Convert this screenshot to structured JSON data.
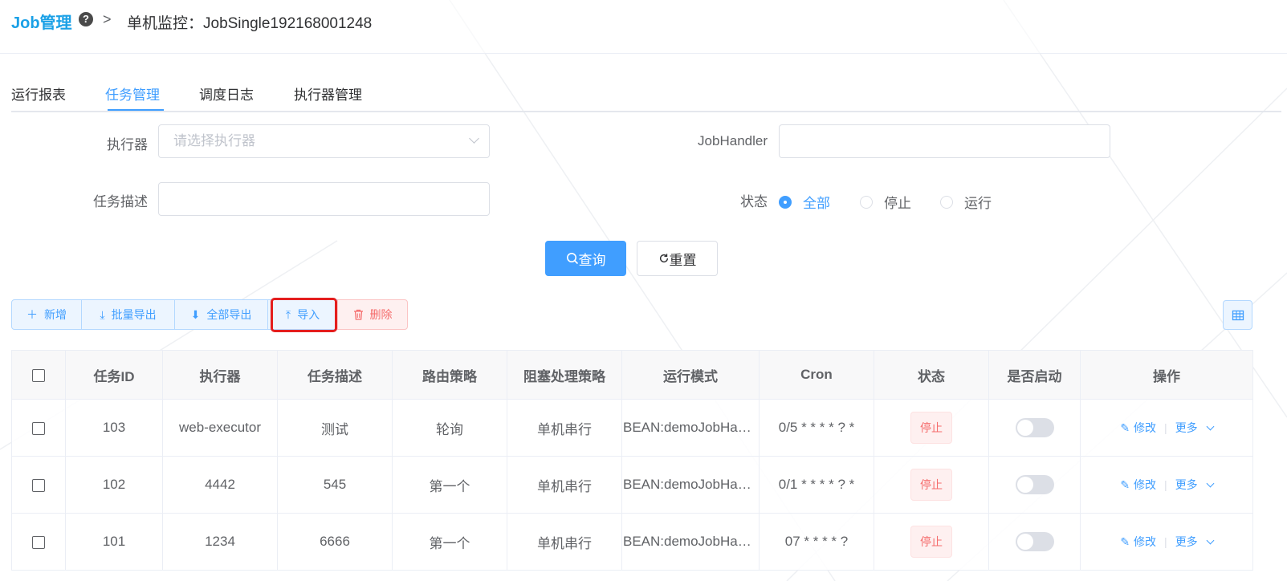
{
  "header": {
    "brand": "Job管理",
    "help_icon": "?",
    "separator": ">",
    "title": "单机监控：JobSingle192168001248"
  },
  "tabs": [
    {
      "label": "运行报表",
      "active": false
    },
    {
      "label": "任务管理",
      "active": true
    },
    {
      "label": "调度日志",
      "active": false
    },
    {
      "label": "执行器管理",
      "active": false
    }
  ],
  "form": {
    "executor_label": "执行器",
    "executor_placeholder": "请选择执行器",
    "jobhandler_label": "JobHandler",
    "jobhandler_value": "",
    "desc_label": "任务描述",
    "desc_value": "",
    "status_label": "状态",
    "status_options": [
      {
        "label": "全部",
        "checked": true
      },
      {
        "label": "停止",
        "checked": false
      },
      {
        "label": "运行",
        "checked": false
      }
    ],
    "search_label": "查询",
    "reset_label": "重置"
  },
  "toolbar": {
    "add": "新增",
    "batch_export": "批量导出",
    "export_all": "全部导出",
    "import": "导入",
    "delete": "删除"
  },
  "table": {
    "headers": [
      "任务ID",
      "执行器",
      "任务描述",
      "路由策略",
      "阻塞处理策略",
      "运行模式",
      "Cron",
      "状态",
      "是否启动",
      "操作"
    ],
    "rows": [
      {
        "id": "103",
        "executor": "web-executor",
        "desc": "测试",
        "route": "轮询",
        "block": "单机串行",
        "mode": "BEAN:demoJobHandler",
        "cron": "0/5 * * * * ? *",
        "status": "停止",
        "enabled": false
      },
      {
        "id": "102",
        "executor": "4442",
        "desc": "545",
        "route": "第一个",
        "block": "单机串行",
        "mode": "BEAN:demoJobHandler",
        "cron": "0/1 * * * * ? *",
        "status": "停止",
        "enabled": false
      },
      {
        "id": "101",
        "executor": "1234",
        "desc": "6666",
        "route": "第一个",
        "block": "单机串行",
        "mode": "BEAN:demoJobHandler",
        "cron": "07 * * * * ?",
        "status": "停止",
        "enabled": false
      }
    ],
    "edit_label": "修改",
    "more_label": "更多"
  },
  "colors": {
    "primary": "#409eff",
    "brand": "#1aa0e6",
    "danger": "#f56c6c",
    "highlight": "#e41e1e"
  }
}
